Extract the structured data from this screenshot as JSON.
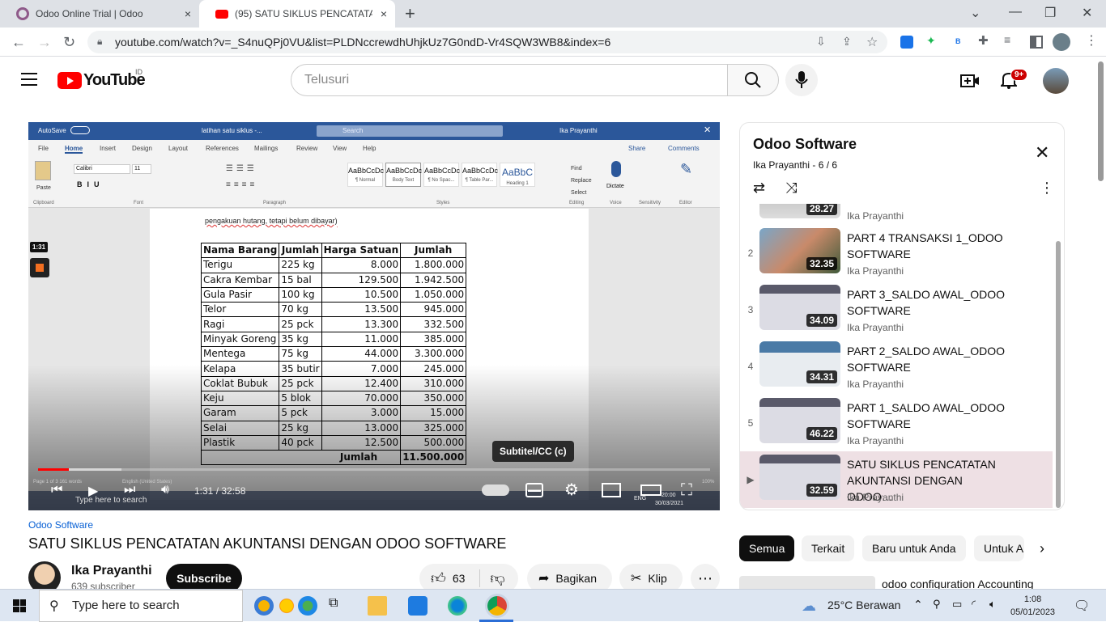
{
  "browser": {
    "tabs": [
      {
        "title": "Odoo Online Trial | Odoo",
        "close": "×"
      },
      {
        "title": "(95) SATU SIKLUS PENCATATAN A",
        "close": "×"
      }
    ],
    "new_tab": "+",
    "url": "youtube.com/watch?v=_S4nuQPj0VU&list=PLDNccrewdhUhjkUz7G0ndD-Vr4SQW3WB8&index=6"
  },
  "youtube": {
    "logo_text": "YouTube",
    "country": "ID",
    "search_placeholder": "Telusuri",
    "notifications": "9+"
  },
  "player": {
    "word": {
      "autosave": "AutoSave",
      "doc_title": "latihan satu siklus  -...",
      "search": "Search",
      "user": "Ika Prayanthi",
      "tabs": [
        "File",
        "Home",
        "Insert",
        "Design",
        "Layout",
        "References",
        "Mailings",
        "Review",
        "View",
        "Help"
      ],
      "share": "Share",
      "comments": "Comments",
      "font": "Calibri",
      "size": "11",
      "styles": [
        {
          "sample": "AaBbCcDc",
          "name": "¶ Normal"
        },
        {
          "sample": "AaBbCcDc",
          "name": "Body Text"
        },
        {
          "sample": "AaBbCcDc",
          "name": "¶ No Spac..."
        },
        {
          "sample": "AaBbCcDc",
          "name": "¶ Table Par..."
        },
        {
          "sample": "AaBbC",
          "name": "Heading 1"
        }
      ],
      "groups": [
        "Clipboard",
        "Font",
        "Paragraph",
        "Styles",
        "Editing",
        "Voice",
        "Sensitivity",
        "Editor"
      ],
      "editing": [
        "Find",
        "Replace",
        "Select"
      ],
      "dictate": "Dictate",
      "paste": "Paste",
      "pretext": "pengakuan hutang, tetapi belum dibayar)",
      "status": "Page 1 of 3    161 words",
      "lang": "English (United States)"
    },
    "table": {
      "headers": [
        "Nama Barang",
        "Jumlah",
        "Harga Satuan",
        "Jumlah"
      ],
      "rows": [
        [
          "Terigu",
          "225 kg",
          "8.000",
          "1.800.000"
        ],
        [
          "Cakra Kembar",
          "15 bal",
          "129.500",
          "1.942.500"
        ],
        [
          "Gula Pasir",
          "100 kg",
          "10.500",
          "1.050.000"
        ],
        [
          "Telor",
          "70 kg",
          "13.500",
          "945.000"
        ],
        [
          "Ragi",
          "25 pck",
          "13.300",
          "332.500"
        ],
        [
          "Minyak Goreng",
          "35 kg",
          "11.000",
          "385.000"
        ],
        [
          "Mentega",
          "75 kg",
          "44.000",
          "3.300.000"
        ],
        [
          "Kelapa",
          "35 butir",
          "7.000",
          "245.000"
        ],
        [
          "Coklat Bubuk",
          "25 pck",
          "12.400",
          "310.000"
        ],
        [
          "Keju",
          "5 blok",
          "70.000",
          "350.000"
        ],
        [
          "Garam",
          "5 pck",
          "3.000",
          "15.000"
        ],
        [
          "Selai",
          "25 kg",
          "13.000",
          "325.000"
        ],
        [
          "Plastik",
          "40 pck",
          "12.500",
          "500.000"
        ]
      ],
      "total_label": "Jumlah",
      "total_value": "11.500.000"
    },
    "overlay_time": "1:31",
    "subtitle_tooltip": "Subtitel/CC (c)",
    "time": "1:31 / 32:58",
    "progress_played": 0.046,
    "progress_loaded": 0.124,
    "inner_taskbar_search": "Type here to search",
    "inner_clock": "20:00",
    "inner_date": "30/03/2021",
    "inner_lang": "ENG",
    "zoom": "100%",
    "focus": "Focus"
  },
  "playlist": {
    "title": "Odoo Software",
    "subtitle": "Ika Prayanthi - 6 / 6",
    "items": [
      {
        "num": "",
        "title": "",
        "channel": "Ika Prayanthi",
        "duration": "28.27"
      },
      {
        "num": "2",
        "title": "PART 4 TRANSAKSI 1_ODOO SOFTWARE",
        "channel": "Ika Prayanthi",
        "duration": "32.35"
      },
      {
        "num": "3",
        "title": "PART 3_SALDO AWAL_ODOO SOFTWARE",
        "channel": "Ika Prayanthi",
        "duration": "34.09"
      },
      {
        "num": "4",
        "title": "PART 2_SALDO AWAL_ODOO SOFTWARE",
        "channel": "Ika Prayanthi",
        "duration": "34.31"
      },
      {
        "num": "5",
        "title": "PART 1_SALDO AWAL_ODOO SOFTWARE",
        "channel": "Ika Prayanthi",
        "duration": "46.22"
      },
      {
        "num": "▶",
        "title": "SATU SIKLUS PENCATATAN AKUNTANSI DENGAN ODOO…",
        "channel": "Ika Prayanthi",
        "duration": "32.59"
      }
    ]
  },
  "video": {
    "channel_link": "Odoo Software",
    "title": "SATU SIKLUS PENCATATAN AKUNTANSI DENGAN ODOO SOFTWARE",
    "channel": "Ika Prayanthi",
    "subscribers": "639 subscriber",
    "subscribe": "Subscribe",
    "likes": "63",
    "share": "Bagikan",
    "clip": "Klip"
  },
  "chips": [
    "Semua",
    "Terkait",
    "Baru untuk Anda",
    "Untuk A"
  ],
  "recommendation_title": "odoo configuration Accounting",
  "taskbar": {
    "search": "Type here to search",
    "weather": "25°C  Berawan",
    "time": "1:08",
    "date": "05/01/2023"
  }
}
